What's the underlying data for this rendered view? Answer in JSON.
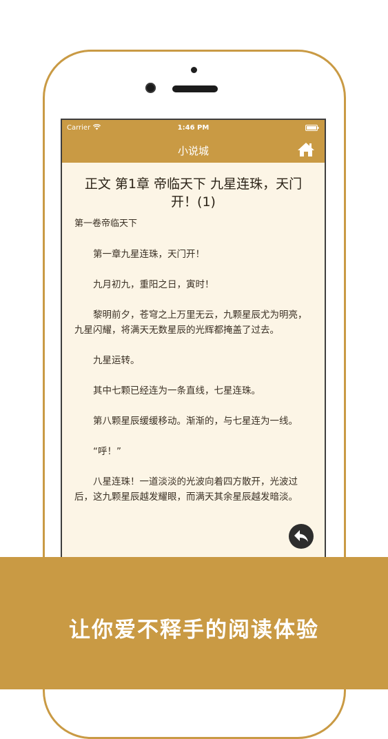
{
  "status_bar": {
    "carrier": "Carrier",
    "time": "1:46 PM"
  },
  "nav": {
    "title": "小说城",
    "home_icon": "home-icon"
  },
  "chapter": {
    "title": "正文 第1章 帝临天下 九星连珠，天门开！(1)",
    "volume": "第一卷帝临天下",
    "paragraphs": [
      "第一章九星连珠，天门开！",
      "九月初九，重阳之日，寅时！",
      "黎明前夕，苍穹之上万里无云，九颗星辰尤为明亮，九星闪耀，将满天无数星辰的光辉都掩盖了过去。",
      "九星运转。",
      "其中七颗已经连为一条直线，七星连珠。",
      "第八颗星辰缓缓移动。渐渐的，与七星连为一线。",
      "“呼！”",
      "八星连珠！一道淡淡的光波向着四方散开，光波过后，这九颗星辰越发耀眼，而满天其余星辰越发暗淡。"
    ]
  },
  "back_icon": "back-arrow-icon",
  "banner": {
    "slogan": "让你爱不释手的阅读体验"
  },
  "colors": {
    "accent": "#c99a44",
    "page_background": "#fcf5e6",
    "text": "#3a3024"
  }
}
